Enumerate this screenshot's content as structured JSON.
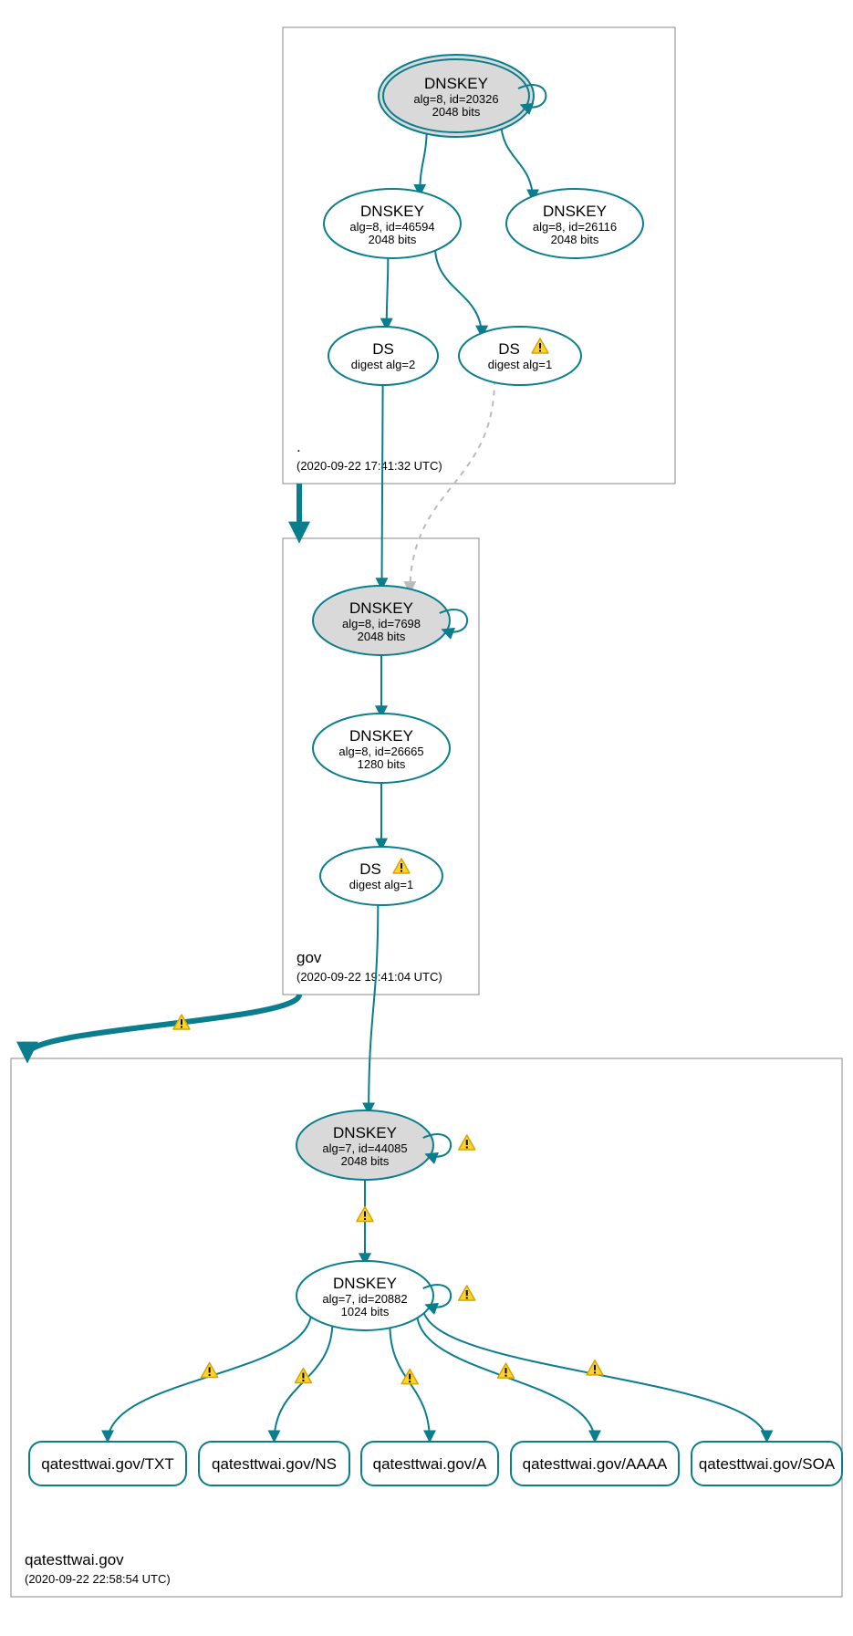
{
  "colors": {
    "accent": "#0a7e8c",
    "ksk_fill": "#d9d9d9",
    "warn_fill": "#ffd42a",
    "warn_stroke": "#d4a500"
  },
  "zones": [
    {
      "name": ".",
      "ts": "(2020-09-22 17:41:32 UTC)"
    },
    {
      "name": "gov",
      "ts": "(2020-09-22 19:41:04 UTC)"
    },
    {
      "name": "qatesttwai.gov",
      "ts": "(2020-09-22 22:58:54 UTC)"
    }
  ],
  "nodes": {
    "root_ksk": {
      "type": "DNSKEY",
      "l1": "DNSKEY",
      "l2": "alg=8, id=20326",
      "l3": "2048 bits",
      "ksk": true,
      "double": true,
      "self": true
    },
    "root_zsk": {
      "type": "DNSKEY",
      "l1": "DNSKEY",
      "l2": "alg=8, id=46594",
      "l3": "2048 bits"
    },
    "root_k2": {
      "type": "DNSKEY",
      "l1": "DNSKEY",
      "l2": "alg=8, id=26116",
      "l3": "2048 bits"
    },
    "root_ds2": {
      "type": "DS",
      "l1": "DS",
      "l2": "digest alg=2"
    },
    "root_ds1": {
      "type": "DS",
      "l1": "DS",
      "l2": "digest alg=1",
      "warn": true
    },
    "gov_ksk": {
      "type": "DNSKEY",
      "l1": "DNSKEY",
      "l2": "alg=8, id=7698",
      "l3": "2048 bits",
      "ksk": true,
      "self": true
    },
    "gov_zsk": {
      "type": "DNSKEY",
      "l1": "DNSKEY",
      "l2": "alg=8, id=26665",
      "l3": "1280 bits"
    },
    "gov_ds": {
      "type": "DS",
      "l1": "DS",
      "l2": "digest alg=1",
      "warn": true
    },
    "q_ksk": {
      "type": "DNSKEY",
      "l1": "DNSKEY",
      "l2": "alg=7, id=44085",
      "l3": "2048 bits",
      "ksk": true,
      "self": true,
      "self_warn": true
    },
    "q_zsk": {
      "type": "DNSKEY",
      "l1": "DNSKEY",
      "l2": "alg=7, id=20882",
      "l3": "1024 bits",
      "self": true,
      "self_warn": true
    }
  },
  "rr": [
    {
      "label": "qatesttwai.gov/TXT"
    },
    {
      "label": "qatesttwai.gov/NS"
    },
    {
      "label": "qatesttwai.gov/A"
    },
    {
      "label": "qatesttwai.gov/AAAA"
    },
    {
      "label": "qatesttwai.gov/SOA"
    }
  ],
  "edges": [
    {
      "from": "root_ksk",
      "to": "root_zsk"
    },
    {
      "from": "root_ksk",
      "to": "root_k2"
    },
    {
      "from": "root_zsk",
      "to": "root_ds2"
    },
    {
      "from": "root_zsk",
      "to": "root_ds1"
    },
    {
      "from": "root_ds2",
      "to": "gov_ksk"
    },
    {
      "from": "root_ds1",
      "to": "gov_ksk",
      "dashed": true
    },
    {
      "from": "gov_ksk",
      "to": "gov_zsk"
    },
    {
      "from": "gov_zsk",
      "to": "gov_ds"
    },
    {
      "from": "gov_ds",
      "to": "q_ksk"
    },
    {
      "from": "q_ksk",
      "to": "q_zsk",
      "warn": true
    },
    {
      "from": "q_zsk",
      "to": "rr0",
      "warn": true
    },
    {
      "from": "q_zsk",
      "to": "rr1",
      "warn": true
    },
    {
      "from": "q_zsk",
      "to": "rr2",
      "warn": true
    },
    {
      "from": "q_zsk",
      "to": "rr3",
      "warn": true
    },
    {
      "from": "q_zsk",
      "to": "rr4",
      "warn": true
    }
  ],
  "delegations": [
    {
      "from_zone": 0,
      "to_zone": 1,
      "warn": false
    },
    {
      "from_zone": 1,
      "to_zone": 2,
      "warn": true
    }
  ]
}
